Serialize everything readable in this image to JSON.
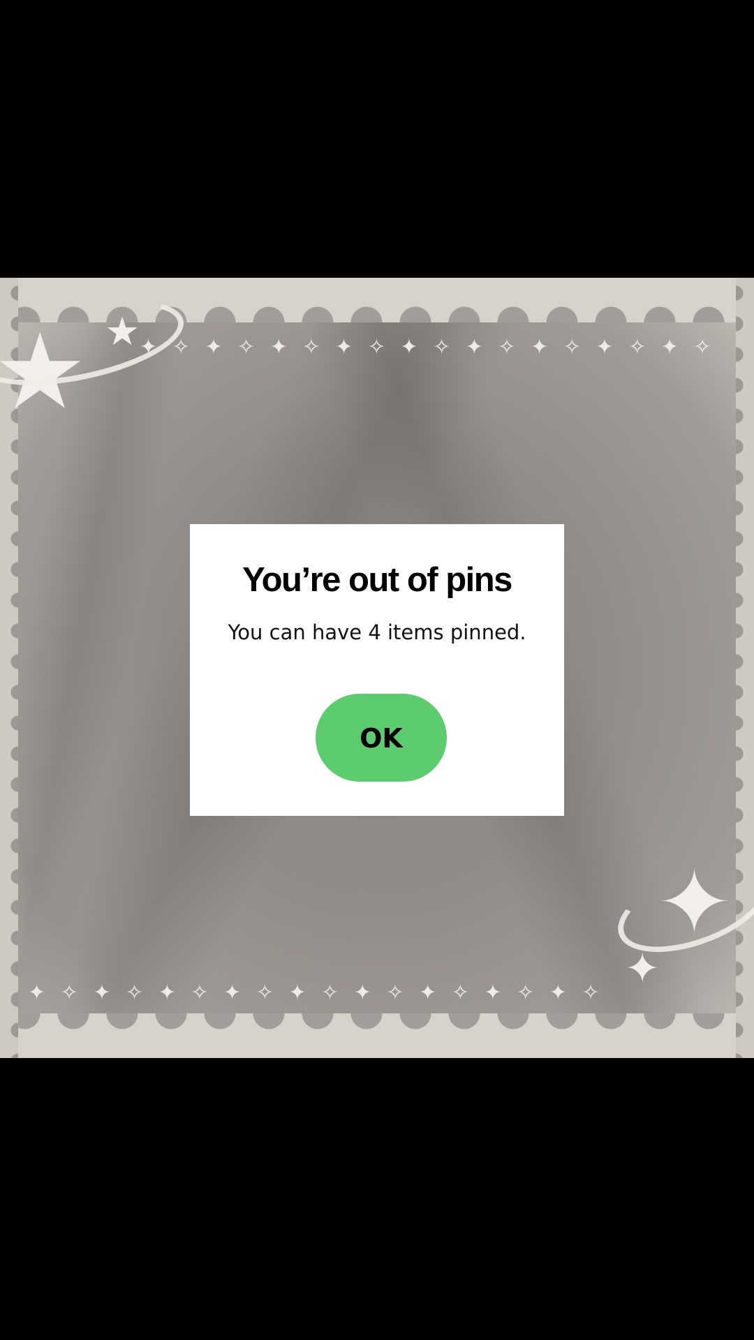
{
  "dialog": {
    "title": "You’re out of pins",
    "message": "You can have 4 items pinned.",
    "ok_label": "OK"
  },
  "colors": {
    "background": "#000000",
    "dialog_background": "#ffffff",
    "ok_button": "#5ccc6e"
  }
}
